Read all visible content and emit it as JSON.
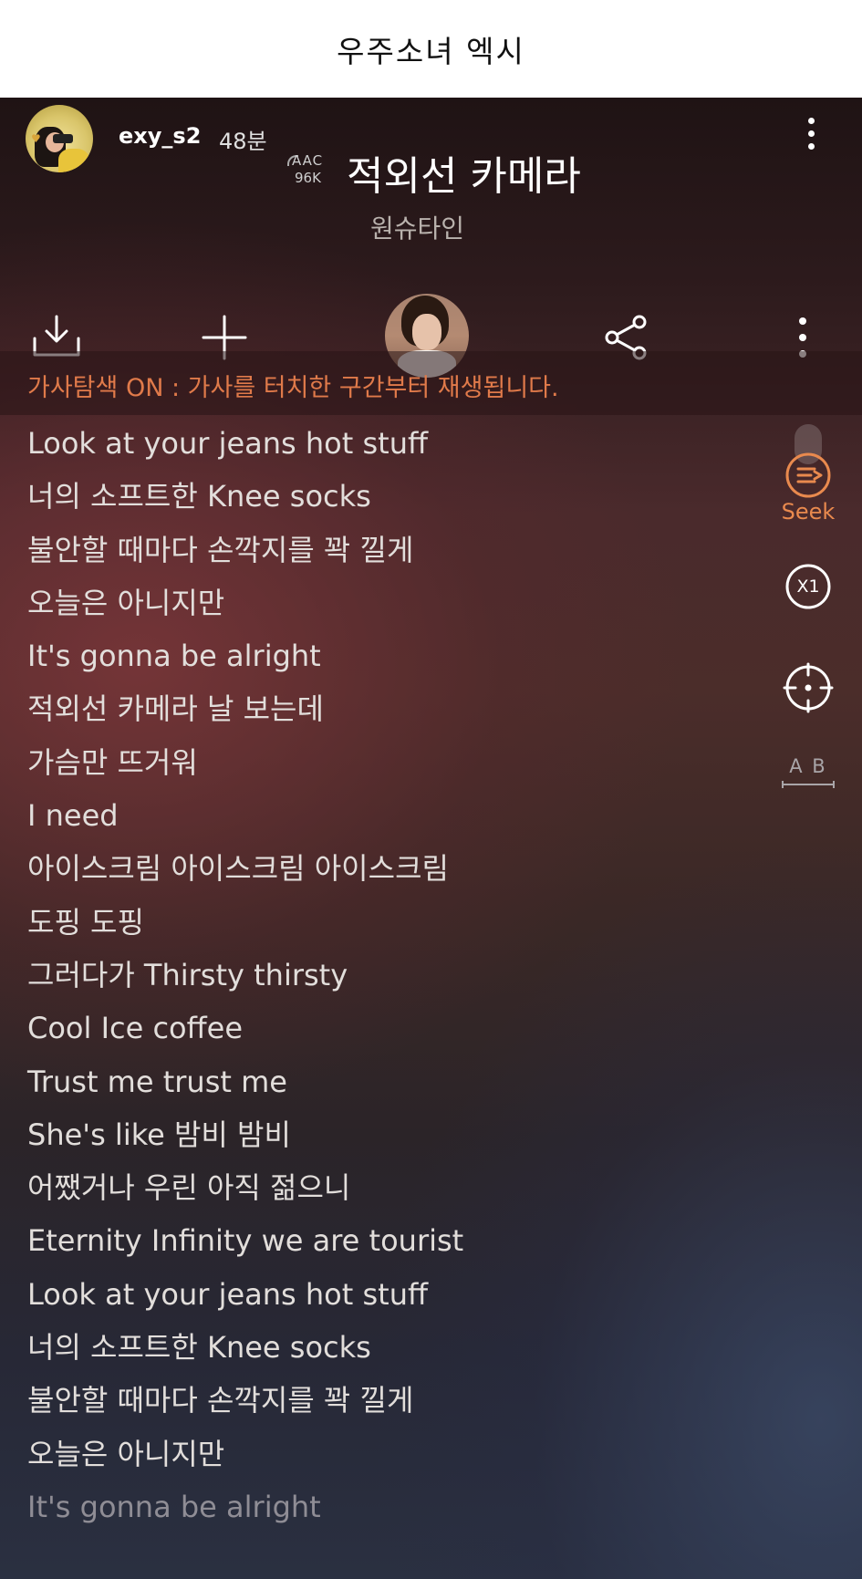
{
  "banner": {
    "title": "우주소녀 엑시"
  },
  "header": {
    "username": "exy_s2",
    "duration": "48분",
    "codec_line1": "AAC",
    "codec_line2": "96K",
    "song_title": "적외선 카메라",
    "artist": "원슈타인"
  },
  "notice": {
    "text": "가사탐색 ON : 가사를 터치한 구간부터 재생됩니다."
  },
  "side": {
    "seek_label": "Seek",
    "speed_label": "X1",
    "ab_label": "A B"
  },
  "lyrics": [
    "Look at your jeans hot stuff",
    "너의 소프트한 Knee socks",
    "불안할 때마다 손깍지를 꽉 낄게",
    "오늘은 아니지만",
    "It's gonna be alright",
    "적외선 카메라 날 보는데",
    "가슴만 뜨거워",
    "I need",
    "아이스크림 아이스크림 아이스크림",
    "도핑 도핑",
    "그러다가 Thirsty thirsty",
    "Cool Ice coffee",
    "Trust me trust me",
    "She's like 밤비 밤비",
    "어쨌거나 우린 아직 젊으니",
    "Eternity Infinity we are tourist",
    "Look at your jeans hot stuff",
    "너의 소프트한 Knee socks",
    "불안할 때마다 손깍지를 꽉 낄게",
    "오늘은 아니지만",
    "It's gonna be alright"
  ],
  "colors": {
    "accent": "#e98a4e",
    "notice": "#e07a4a"
  },
  "icons": [
    "download-icon",
    "add-icon",
    "share-icon",
    "more-vert-icon",
    "seek-icon",
    "speed-icon",
    "locate-icon",
    "ab-repeat-icon"
  ]
}
